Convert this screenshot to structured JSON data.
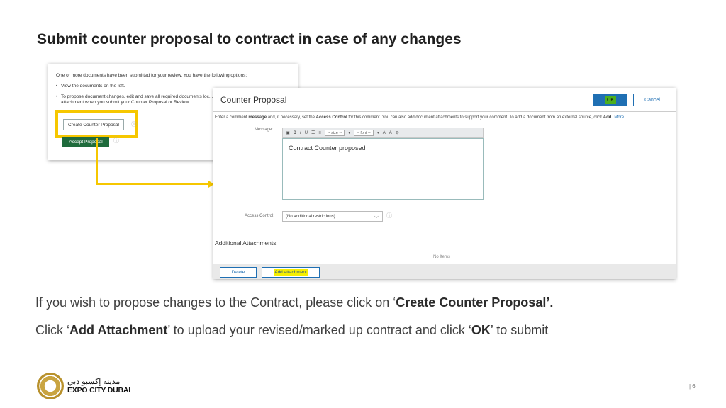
{
  "slide": {
    "title": "Submit counter proposal to contract in case of any changes",
    "paragraph1": {
      "pre": "If you wish to propose changes to the Contract, please click on ‘",
      "bold": "Create Counter Proposal’.",
      "post": ""
    },
    "paragraph2": {
      "pre": "Click ‘",
      "bold1": "Add Attachment",
      "mid": "’ to upload your revised/marked up contract and click ‘",
      "bold2": "OK",
      "post": "’ to submit"
    },
    "page_number": "| 6"
  },
  "review_panel": {
    "intro": "One or more documents have been submitted for your review. You have the following options:",
    "bullet1": "View the documents on the left.",
    "bullet2": "To propose document changes, edit and save all required documents loc... attachment when you submit your Counter Proposal or Review.",
    "create_button": "Create Counter Proposal",
    "accept_button": "Accept Proposal",
    "info_glyph": "ⓘ"
  },
  "dialog": {
    "title": "Counter Proposal",
    "ok_label": "OK",
    "cancel_label": "Cancel",
    "instructions": {
      "p1": "Enter a comment ",
      "b1": "message",
      "p2": " and, if necessary, set the ",
      "b2": "Access Control",
      "p3": " for this comment. You can also add document attachments to support your comment. To add a document from an external source, click ",
      "b3": "Add",
      "more": "More"
    },
    "message_label": "Message:",
    "toolbar": {
      "size_select": "-- size --",
      "font_select": "-- font --"
    },
    "message_text": "Contract Counter proposed",
    "access_control_label": "Access Control:",
    "access_control_value": "(No additional restrictions)",
    "attachments_title": "Additional Attachments",
    "no_items": "No Items",
    "delete_label": "Delete",
    "add_attachment_label": "Add attachment"
  },
  "logo": {
    "arabic": "مدينة إكسبو دبي",
    "english": "EXPO CITY DUBAI"
  },
  "colors": {
    "highlight": "#f6c700",
    "accent_blue": "#1f6fb3",
    "ok_green": "#4caf1e",
    "accept_green": "#1f6b3c"
  }
}
